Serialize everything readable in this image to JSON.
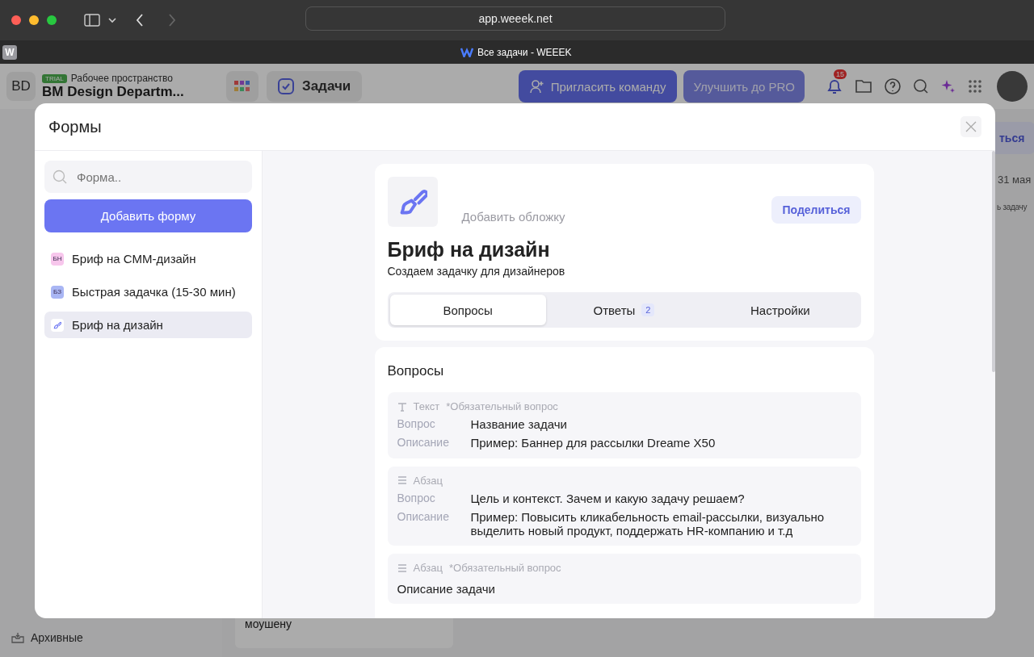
{
  "browser": {
    "url": "app.weeek.net",
    "tab_title": "Все задачи - WEEEK",
    "tab_favicon": "W"
  },
  "app": {
    "avatar": "BD",
    "trial": "TRIAL",
    "workspace_label": "Рабочее пространство",
    "workspace_name": "BM Design Departm...",
    "breadcrumb": "Задачи",
    "invite": "Пригласить команду",
    "upgrade": "Улучшить до PRO",
    "notifications": "15",
    "archive": "Архивные",
    "share_fragment": "ться",
    "date_fragment": "31 мая",
    "add_task_fragment": "ь задачу",
    "card_fragment": "моушену"
  },
  "modal": {
    "title": "Формы",
    "search": {
      "placeholder": "Форма.."
    },
    "add_button": "Добавить форму",
    "forms": [
      {
        "kind": "initials",
        "icon_text": "БН",
        "color": "#f7c6ec",
        "name": "Бриф на СММ-дизайн",
        "selected": false
      },
      {
        "kind": "initials",
        "icon_text": "БЗ",
        "color": "#a9b6f4",
        "name": "Быстрая задачка (15-30 мин)",
        "selected": false
      },
      {
        "kind": "brush",
        "name": "Бриф на дизайн",
        "selected": true
      }
    ],
    "form": {
      "cover": "Добавить обложку",
      "share": "Поделиться",
      "title": "Бриф на дизайн",
      "subtitle": "Создаем задачку для дизайнеров",
      "tabs": [
        {
          "label": "Вопросы",
          "selected": true
        },
        {
          "label": "Ответы",
          "badge": "2",
          "selected": false
        },
        {
          "label": "Настройки",
          "selected": false
        }
      ],
      "section_title": "Вопросы",
      "questions": [
        {
          "kind": "text",
          "type_label": "Текст",
          "required": "*Обязательный вопрос",
          "rows": [
            {
              "label": "Вопрос",
              "value": "Название задачи"
            },
            {
              "label": "Описание",
              "value": "Пример: Баннер для рассылки Dreame X50"
            }
          ]
        },
        {
          "kind": "paragraph",
          "type_label": "Абзац",
          "rows": [
            {
              "label": "Вопрос",
              "value": "Цель и контекст. Зачем и какую задачу решаем?"
            },
            {
              "label": "Описание",
              "value": "Пример: Повысить кликабельность email-рассылки, визуально выделить новый продукт, поддержать HR-компанию и т.д"
            }
          ]
        },
        {
          "kind": "paragraph",
          "type_label": "Абзац",
          "required": "*Обязательный вопрос",
          "title": "Описание задачи"
        }
      ]
    }
  }
}
